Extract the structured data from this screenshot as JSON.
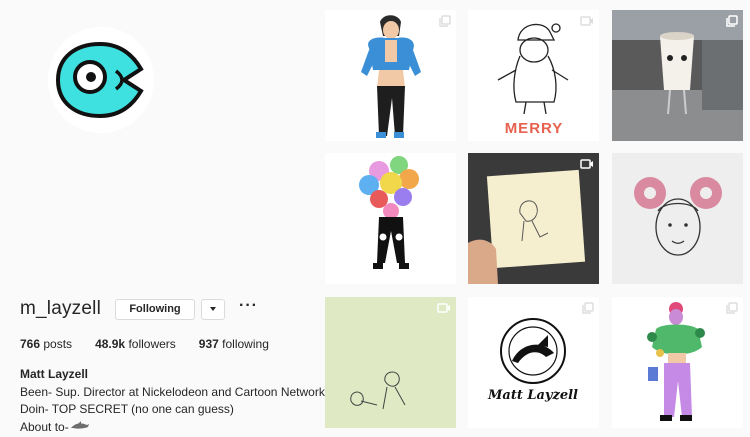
{
  "profile": {
    "username": "m_layzell",
    "follow_label": "Following",
    "more_label": "···",
    "stats": {
      "posts_count": "766",
      "posts_label": "posts",
      "followers_count": "48.9k",
      "followers_label": "followers",
      "following_count": "937",
      "following_label": "following"
    },
    "bio": {
      "name": "Matt Layzell",
      "line1": "Been- Sup. Director at Nickelodeon and Cartoon Network",
      "line2": "Doin- TOP SECRET (no one can guess)",
      "line3": "About to-"
    }
  },
  "posts": [
    {
      "subject": "character-blue-jacket",
      "badge": "multi-photo-icon"
    },
    {
      "subject": "santa-sketch",
      "caption": "MERRY",
      "badge": "video-icon"
    },
    {
      "subject": "cup-character-photo",
      "badge": "multi-photo-icon"
    },
    {
      "subject": "character-toy-pile",
      "badge": "none"
    },
    {
      "subject": "sticky-note-sketch",
      "badge": "video-icon"
    },
    {
      "subject": "donut-buns-face",
      "badge": "none"
    },
    {
      "subject": "pencil-sketch-green",
      "badge": "video-icon"
    },
    {
      "subject": "logo-drawing",
      "signature": "Matt Layzell",
      "badge": "multi-photo-icon"
    },
    {
      "subject": "character-purple-pants",
      "badge": "multi-photo-icon"
    }
  ],
  "colors": {
    "avatar_fish": "#3fe0e0",
    "text": "#262626",
    "button_border": "#dbdbdb",
    "caption_red": "#e8614f",
    "page_bg": "#fafafa"
  }
}
